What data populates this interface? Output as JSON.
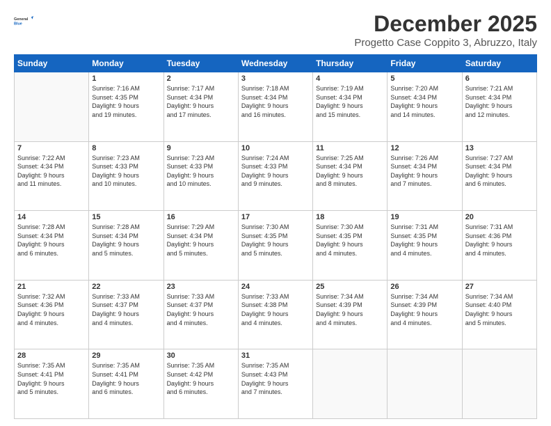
{
  "logo": {
    "line1": "General",
    "line2": "Blue"
  },
  "title": "December 2025",
  "subtitle": "Progetto Case Coppito 3, Abruzzo, Italy",
  "headers": [
    "Sunday",
    "Monday",
    "Tuesday",
    "Wednesday",
    "Thursday",
    "Friday",
    "Saturday"
  ],
  "weeks": [
    [
      {
        "day": "",
        "info": ""
      },
      {
        "day": "1",
        "info": "Sunrise: 7:16 AM\nSunset: 4:35 PM\nDaylight: 9 hours\nand 19 minutes."
      },
      {
        "day": "2",
        "info": "Sunrise: 7:17 AM\nSunset: 4:34 PM\nDaylight: 9 hours\nand 17 minutes."
      },
      {
        "day": "3",
        "info": "Sunrise: 7:18 AM\nSunset: 4:34 PM\nDaylight: 9 hours\nand 16 minutes."
      },
      {
        "day": "4",
        "info": "Sunrise: 7:19 AM\nSunset: 4:34 PM\nDaylight: 9 hours\nand 15 minutes."
      },
      {
        "day": "5",
        "info": "Sunrise: 7:20 AM\nSunset: 4:34 PM\nDaylight: 9 hours\nand 14 minutes."
      },
      {
        "day": "6",
        "info": "Sunrise: 7:21 AM\nSunset: 4:34 PM\nDaylight: 9 hours\nand 12 minutes."
      }
    ],
    [
      {
        "day": "7",
        "info": "Sunrise: 7:22 AM\nSunset: 4:34 PM\nDaylight: 9 hours\nand 11 minutes."
      },
      {
        "day": "8",
        "info": "Sunrise: 7:23 AM\nSunset: 4:33 PM\nDaylight: 9 hours\nand 10 minutes."
      },
      {
        "day": "9",
        "info": "Sunrise: 7:23 AM\nSunset: 4:33 PM\nDaylight: 9 hours\nand 10 minutes."
      },
      {
        "day": "10",
        "info": "Sunrise: 7:24 AM\nSunset: 4:33 PM\nDaylight: 9 hours\nand 9 minutes."
      },
      {
        "day": "11",
        "info": "Sunrise: 7:25 AM\nSunset: 4:34 PM\nDaylight: 9 hours\nand 8 minutes."
      },
      {
        "day": "12",
        "info": "Sunrise: 7:26 AM\nSunset: 4:34 PM\nDaylight: 9 hours\nand 7 minutes."
      },
      {
        "day": "13",
        "info": "Sunrise: 7:27 AM\nSunset: 4:34 PM\nDaylight: 9 hours\nand 6 minutes."
      }
    ],
    [
      {
        "day": "14",
        "info": "Sunrise: 7:28 AM\nSunset: 4:34 PM\nDaylight: 9 hours\nand 6 minutes."
      },
      {
        "day": "15",
        "info": "Sunrise: 7:28 AM\nSunset: 4:34 PM\nDaylight: 9 hours\nand 5 minutes."
      },
      {
        "day": "16",
        "info": "Sunrise: 7:29 AM\nSunset: 4:34 PM\nDaylight: 9 hours\nand 5 minutes."
      },
      {
        "day": "17",
        "info": "Sunrise: 7:30 AM\nSunset: 4:35 PM\nDaylight: 9 hours\nand 5 minutes."
      },
      {
        "day": "18",
        "info": "Sunrise: 7:30 AM\nSunset: 4:35 PM\nDaylight: 9 hours\nand 4 minutes."
      },
      {
        "day": "19",
        "info": "Sunrise: 7:31 AM\nSunset: 4:35 PM\nDaylight: 9 hours\nand 4 minutes."
      },
      {
        "day": "20",
        "info": "Sunrise: 7:31 AM\nSunset: 4:36 PM\nDaylight: 9 hours\nand 4 minutes."
      }
    ],
    [
      {
        "day": "21",
        "info": "Sunrise: 7:32 AM\nSunset: 4:36 PM\nDaylight: 9 hours\nand 4 minutes."
      },
      {
        "day": "22",
        "info": "Sunrise: 7:33 AM\nSunset: 4:37 PM\nDaylight: 9 hours\nand 4 minutes."
      },
      {
        "day": "23",
        "info": "Sunrise: 7:33 AM\nSunset: 4:37 PM\nDaylight: 9 hours\nand 4 minutes."
      },
      {
        "day": "24",
        "info": "Sunrise: 7:33 AM\nSunset: 4:38 PM\nDaylight: 9 hours\nand 4 minutes."
      },
      {
        "day": "25",
        "info": "Sunrise: 7:34 AM\nSunset: 4:39 PM\nDaylight: 9 hours\nand 4 minutes."
      },
      {
        "day": "26",
        "info": "Sunrise: 7:34 AM\nSunset: 4:39 PM\nDaylight: 9 hours\nand 4 minutes."
      },
      {
        "day": "27",
        "info": "Sunrise: 7:34 AM\nSunset: 4:40 PM\nDaylight: 9 hours\nand 5 minutes."
      }
    ],
    [
      {
        "day": "28",
        "info": "Sunrise: 7:35 AM\nSunset: 4:41 PM\nDaylight: 9 hours\nand 5 minutes."
      },
      {
        "day": "29",
        "info": "Sunrise: 7:35 AM\nSunset: 4:41 PM\nDaylight: 9 hours\nand 6 minutes."
      },
      {
        "day": "30",
        "info": "Sunrise: 7:35 AM\nSunset: 4:42 PM\nDaylight: 9 hours\nand 6 minutes."
      },
      {
        "day": "31",
        "info": "Sunrise: 7:35 AM\nSunset: 4:43 PM\nDaylight: 9 hours\nand 7 minutes."
      },
      {
        "day": "",
        "info": ""
      },
      {
        "day": "",
        "info": ""
      },
      {
        "day": "",
        "info": ""
      }
    ]
  ]
}
